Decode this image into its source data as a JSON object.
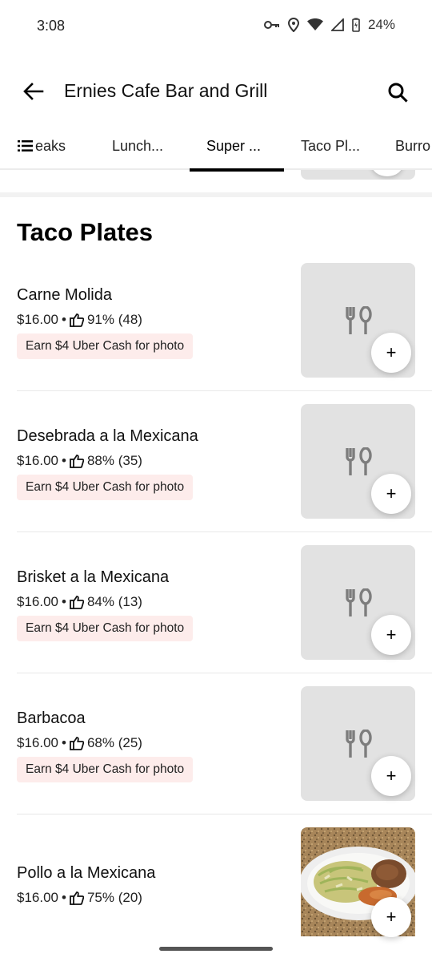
{
  "status_bar": {
    "time": "3:08",
    "battery": "24%",
    "icons": [
      "vpn-key-icon",
      "location-icon",
      "wifi-icon",
      "signal-icon",
      "battery-charging-icon"
    ]
  },
  "header": {
    "title": "Ernies Cafe Bar and Grill",
    "back_icon": "arrow-left-icon",
    "search_icon": "search-icon"
  },
  "tabs": {
    "list_icon": "list-icon",
    "items": [
      "eaks",
      "Lunch...",
      "Super ...",
      "Taco Pl...",
      "Burro"
    ],
    "active_index": 2
  },
  "section": {
    "title": "Taco Plates"
  },
  "items": [
    {
      "name": "Carne Molida",
      "price": "$16.00",
      "rating": "91% (48)",
      "promo": "Earn $4 Uber Cash for photo",
      "has_photo": false
    },
    {
      "name": "Desebrada a la Mexicana",
      "price": "$16.00",
      "rating": "88% (35)",
      "promo": "Earn $4 Uber Cash for photo",
      "has_photo": false
    },
    {
      "name": "Brisket a la Mexicana",
      "price": "$16.00",
      "rating": "84% (13)",
      "promo": "Earn $4 Uber Cash for photo",
      "has_photo": false
    },
    {
      "name": "Barbacoa",
      "price": "$16.00",
      "rating": "68% (25)",
      "promo": "Earn $4 Uber Cash for photo",
      "has_photo": false
    },
    {
      "name": "Pollo a la Mexicana",
      "price": "$16.00",
      "rating": "75% (20)",
      "promo": "",
      "has_photo": true
    }
  ],
  "labels": {
    "bullet": "•",
    "add": "+"
  },
  "colors": {
    "promo_bg": "#fdeceb",
    "thumb_bg": "#e2e2e2",
    "active_tab": "#000000"
  }
}
